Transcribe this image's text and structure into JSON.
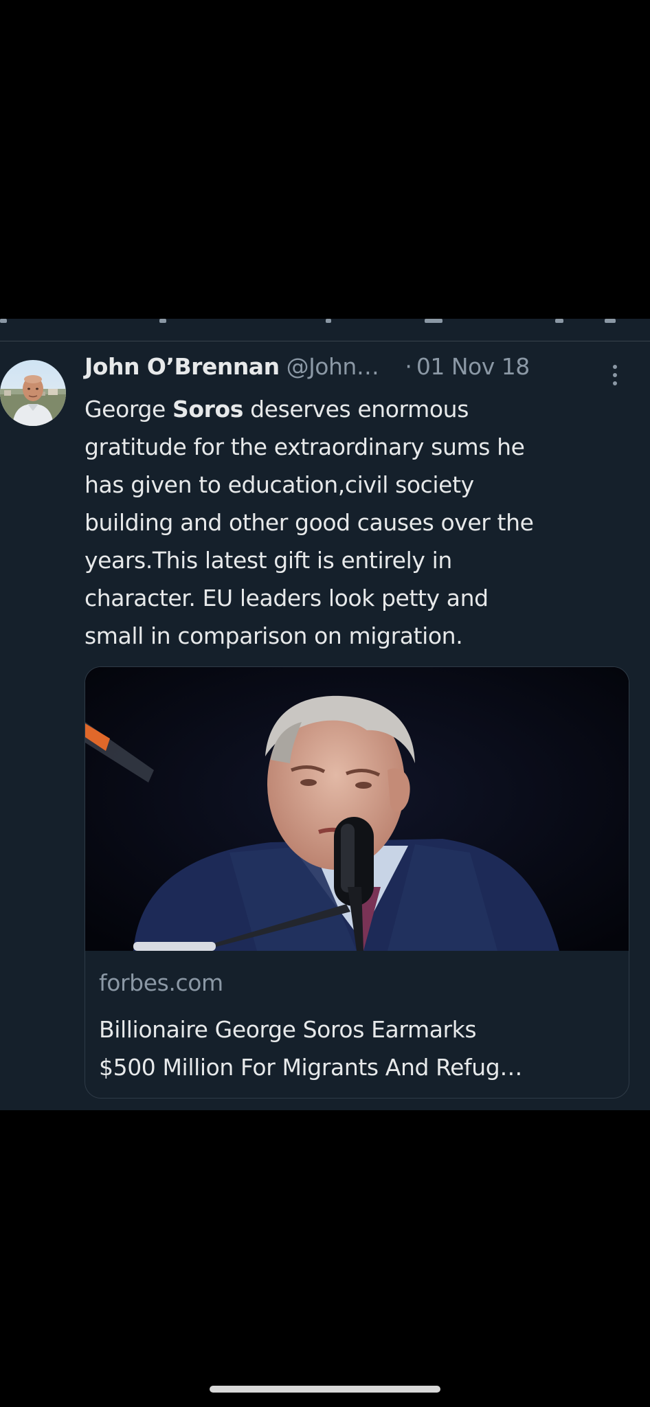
{
  "tweet": {
    "author_name": "John O’Brennan",
    "author_handle": "@John…",
    "separator": "·",
    "date": "01 Nov 18",
    "text_lines": [
      {
        "plain": "George ",
        "bold": "Soros",
        "rest": " deserves enormous"
      },
      {
        "plain": "gratitude for the extraordinary sums he"
      },
      {
        "plain": "has given to education,civil society"
      },
      {
        "plain": "building and other good causes over the"
      },
      {
        "plain": "years.This latest gift is entirely in"
      },
      {
        "plain": "character. EU leaders look petty and"
      },
      {
        "plain": "small in comparison on migration."
      }
    ]
  },
  "link_card": {
    "domain": "forbes.com",
    "title_lines": [
      "Billionaire George Soros Earmarks",
      "$500 Million For Migrants And Refug…"
    ]
  },
  "icons": {
    "avatar": "avatar-photo",
    "more": "more-vertical-icon"
  },
  "colors": {
    "background": "#15202b",
    "primary_text": "#e7e9ea",
    "secondary_text": "#8b98a5",
    "border": "#38444d"
  }
}
